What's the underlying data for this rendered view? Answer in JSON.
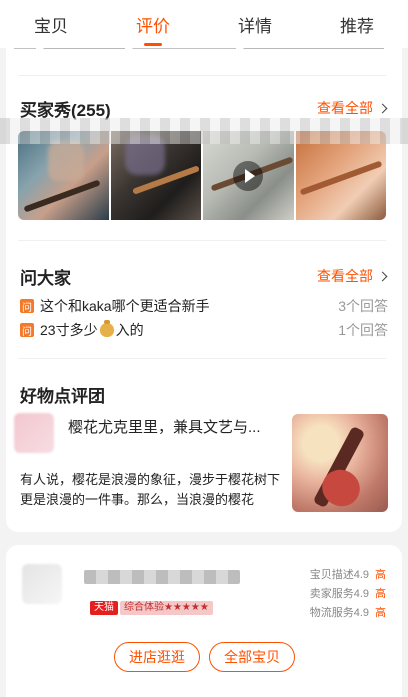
{
  "tabs": [
    "宝贝",
    "评价",
    "详情",
    "推荐"
  ],
  "buyer_show": {
    "title": "买家秀(255)",
    "see_all": "查看全部"
  },
  "ask": {
    "title": "问大家",
    "see_all": "查看全部",
    "badge": "问",
    "questions": [
      {
        "text": "这个和kaka哪个更适合新手",
        "answers": "3个回答"
      },
      {
        "text_before": "23寸多少",
        "text_after": "入的",
        "answers": "1个回答"
      }
    ]
  },
  "review_group": {
    "title": "好物点评团",
    "article_title": "樱花尤克里里，兼具文艺与...",
    "article_desc": "有人说，樱花是浪漫的象征，漫步于樱花树下更是浪漫的一件事。那么，当浪漫的樱花"
  },
  "shop": {
    "tmall_badge": "天猫",
    "rating_label": "综合体验★★★★★",
    "ratings": [
      {
        "label": "宝贝描述4.9",
        "level": "高"
      },
      {
        "label": "卖家服务4.9",
        "level": "高"
      },
      {
        "label": "物流服务4.9",
        "level": "高"
      }
    ],
    "btn_enter": "进店逛逛",
    "btn_all": "全部宝贝"
  },
  "colors": {
    "accent": "#ff5000",
    "badge": "#f37a2b"
  }
}
